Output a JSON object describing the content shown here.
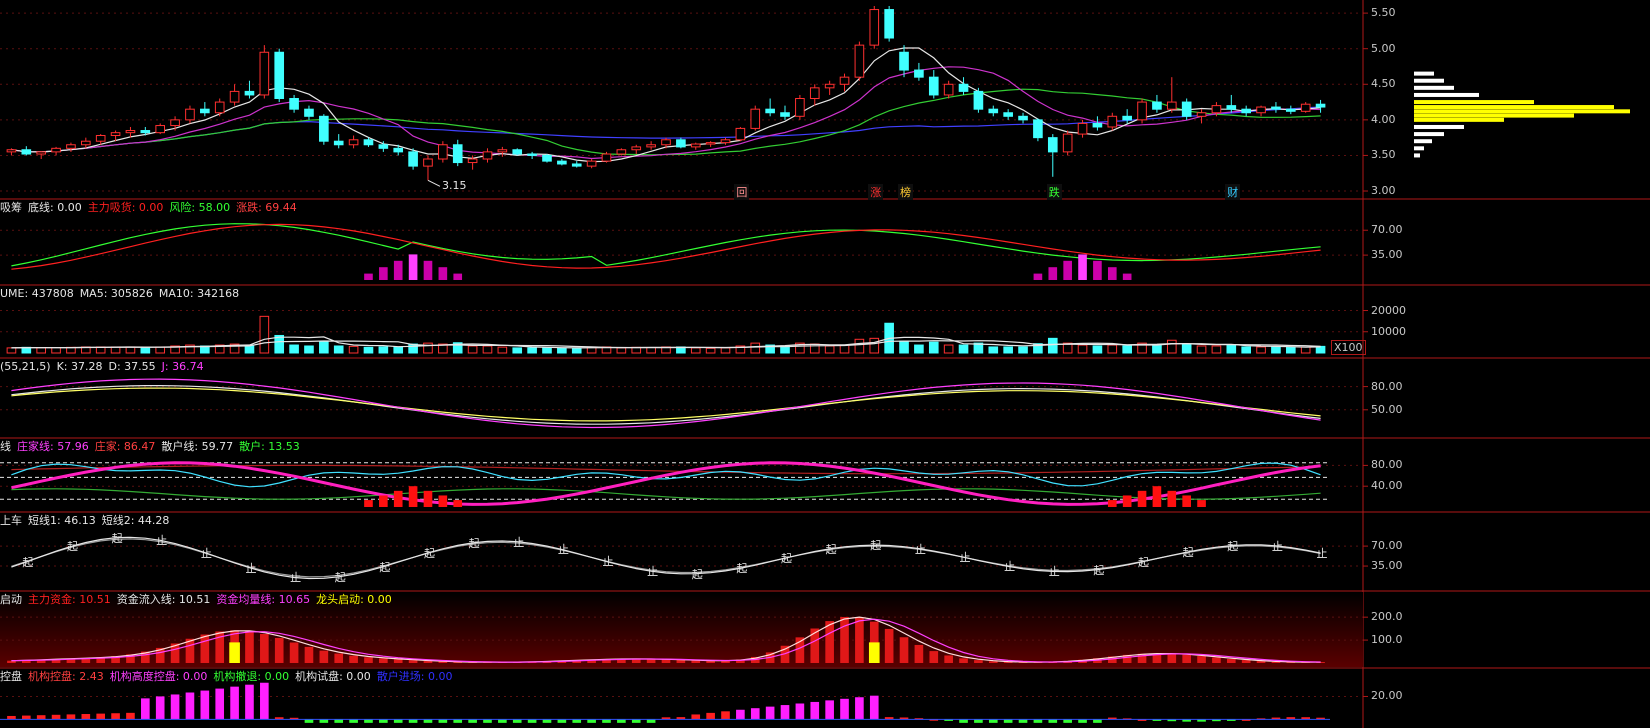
{
  "chart_data": {
    "type": "candlestick-multi-indicator",
    "panels": [
      {
        "id": "price",
        "yticks": [
          "5.50",
          "5.00",
          "4.50",
          "4.00",
          "3.50",
          "3.00"
        ],
        "ytick_values": [
          5.5,
          5.0,
          4.5,
          4.0,
          3.5,
          3.0
        ],
        "ylim": [
          2.93,
          5.6
        ],
        "low_marker": "3.15",
        "event_markers": [
          "回",
          "涨",
          "榜",
          "跌",
          "财"
        ],
        "candles_ohlc": [
          [
            3.55,
            3.6,
            3.5,
            3.58
          ],
          [
            3.58,
            3.63,
            3.5,
            3.52
          ],
          [
            3.52,
            3.56,
            3.45,
            3.55
          ],
          [
            3.55,
            3.62,
            3.5,
            3.6
          ],
          [
            3.6,
            3.68,
            3.55,
            3.65
          ],
          [
            3.65,
            3.75,
            3.6,
            3.7
          ],
          [
            3.7,
            3.8,
            3.65,
            3.78
          ],
          [
            3.78,
            3.85,
            3.7,
            3.82
          ],
          [
            3.82,
            3.9,
            3.75,
            3.85
          ],
          [
            3.85,
            3.9,
            3.78,
            3.82
          ],
          [
            3.82,
            3.95,
            3.8,
            3.92
          ],
          [
            3.92,
            4.05,
            3.85,
            4.0
          ],
          [
            4.0,
            4.2,
            3.95,
            4.15
          ],
          [
            4.15,
            4.25,
            4.05,
            4.1
          ],
          [
            4.1,
            4.3,
            4.05,
            4.25
          ],
          [
            4.25,
            4.5,
            4.2,
            4.4
          ],
          [
            4.4,
            4.55,
            4.3,
            4.35
          ],
          [
            4.35,
            5.05,
            4.3,
            4.95
          ],
          [
            4.95,
            5.0,
            4.25,
            4.3
          ],
          [
            4.3,
            4.35,
            4.1,
            4.15
          ],
          [
            4.15,
            4.2,
            4.0,
            4.05
          ],
          [
            4.05,
            4.08,
            3.65,
            3.7
          ],
          [
            3.7,
            3.8,
            3.6,
            3.65
          ],
          [
            3.65,
            3.78,
            3.6,
            3.72
          ],
          [
            3.72,
            3.75,
            3.62,
            3.65
          ],
          [
            3.65,
            3.7,
            3.55,
            3.6
          ],
          [
            3.6,
            3.65,
            3.5,
            3.55
          ],
          [
            3.55,
            3.6,
            3.3,
            3.35
          ],
          [
            3.35,
            3.5,
            3.15,
            3.45
          ],
          [
            3.45,
            3.7,
            3.4,
            3.65
          ],
          [
            3.65,
            3.72,
            3.35,
            3.4
          ],
          [
            3.4,
            3.5,
            3.3,
            3.45
          ],
          [
            3.45,
            3.6,
            3.4,
            3.55
          ],
          [
            3.55,
            3.62,
            3.48,
            3.58
          ],
          [
            3.58,
            3.6,
            3.5,
            3.52
          ],
          [
            3.52,
            3.55,
            3.45,
            3.5
          ],
          [
            3.5,
            3.52,
            3.4,
            3.42
          ],
          [
            3.42,
            3.45,
            3.36,
            3.38
          ],
          [
            3.38,
            3.42,
            3.33,
            3.35
          ],
          [
            3.35,
            3.45,
            3.32,
            3.42
          ],
          [
            3.42,
            3.55,
            3.4,
            3.52
          ],
          [
            3.52,
            3.6,
            3.5,
            3.58
          ],
          [
            3.58,
            3.65,
            3.52,
            3.62
          ],
          [
            3.62,
            3.7,
            3.58,
            3.65
          ],
          [
            3.65,
            3.75,
            3.6,
            3.72
          ],
          [
            3.72,
            3.75,
            3.6,
            3.62
          ],
          [
            3.62,
            3.68,
            3.58,
            3.66
          ],
          [
            3.66,
            3.7,
            3.62,
            3.68
          ],
          [
            3.68,
            3.75,
            3.65,
            3.72
          ],
          [
            3.72,
            3.9,
            3.7,
            3.88
          ],
          [
            3.88,
            4.2,
            3.85,
            4.15
          ],
          [
            4.15,
            4.3,
            4.05,
            4.1
          ],
          [
            4.1,
            4.2,
            4.0,
            4.05
          ],
          [
            4.05,
            4.35,
            4.0,
            4.3
          ],
          [
            4.3,
            4.5,
            4.2,
            4.45
          ],
          [
            4.45,
            4.55,
            4.35,
            4.5
          ],
          [
            4.5,
            4.65,
            4.4,
            4.6
          ],
          [
            4.6,
            5.1,
            4.55,
            5.05
          ],
          [
            5.05,
            5.6,
            5.0,
            5.55
          ],
          [
            5.55,
            5.6,
            5.1,
            5.15
          ],
          [
            4.95,
            5.05,
            4.6,
            4.7
          ],
          [
            4.7,
            4.8,
            4.55,
            4.6
          ],
          [
            4.6,
            4.7,
            4.3,
            4.35
          ],
          [
            4.35,
            4.55,
            4.3,
            4.5
          ],
          [
            4.5,
            4.6,
            4.35,
            4.4
          ],
          [
            4.4,
            4.45,
            4.1,
            4.15
          ],
          [
            4.15,
            4.2,
            4.05,
            4.1
          ],
          [
            4.1,
            4.15,
            4.0,
            4.05
          ],
          [
            4.05,
            4.1,
            3.95,
            4.0
          ],
          [
            4.0,
            4.02,
            3.7,
            3.75
          ],
          [
            3.75,
            3.8,
            3.2,
            3.55
          ],
          [
            3.55,
            3.85,
            3.5,
            3.8
          ],
          [
            3.8,
            4.0,
            3.75,
            3.95
          ],
          [
            3.95,
            4.05,
            3.85,
            3.9
          ],
          [
            3.9,
            4.1,
            3.85,
            4.05
          ],
          [
            4.05,
            4.15,
            3.95,
            4.0
          ],
          [
            4.0,
            4.3,
            3.95,
            4.25
          ],
          [
            4.25,
            4.35,
            4.1,
            4.15
          ],
          [
            4.15,
            4.6,
            4.1,
            4.25
          ],
          [
            4.25,
            4.3,
            4.0,
            4.05
          ],
          [
            4.05,
            4.15,
            3.95,
            4.1
          ],
          [
            4.1,
            4.25,
            4.05,
            4.2
          ],
          [
            4.2,
            4.35,
            4.1,
            4.15
          ],
          [
            4.15,
            4.2,
            4.05,
            4.1
          ],
          [
            4.1,
            4.2,
            4.05,
            4.18
          ],
          [
            4.18,
            4.25,
            4.1,
            4.15
          ],
          [
            4.15,
            4.2,
            4.08,
            4.12
          ],
          [
            4.12,
            4.25,
            4.1,
            4.22
          ],
          [
            4.22,
            4.28,
            4.1,
            4.18
          ]
        ]
      },
      {
        "id": "chip",
        "legend": [
          {
            "label": "吸筹",
            "value": "",
            "color": "#e6e6e6"
          },
          {
            "label": "底线",
            "value": "0.00",
            "color": "#e6e6e6"
          },
          {
            "label": "主力吸货",
            "value": "0.00",
            "color": "#ff2020"
          },
          {
            "label": "风险",
            "value": "58.00",
            "color": "#33ff33"
          },
          {
            "label": "涨跌",
            "value": "69.44",
            "color": "#ff4040"
          }
        ],
        "yticks": [
          "70.00",
          "35.00"
        ],
        "ytick_values": [
          70,
          35
        ],
        "ylim": [
          0,
          90
        ]
      },
      {
        "id": "volume",
        "legend": [
          {
            "label": "UME",
            "value": "437808",
            "color": "#e6e6e6"
          },
          {
            "label": "MA5",
            "value": "305826",
            "color": "#e6e6e6"
          },
          {
            "label": "MA10",
            "value": "342168",
            "color": "#e6e6e6"
          }
        ],
        "yticks": [
          "20000",
          "10000"
        ],
        "ytick_values": [
          20000,
          10000
        ],
        "ylim": [
          0,
          24000
        ],
        "unit": "X100"
      },
      {
        "id": "kdj",
        "legend": [
          {
            "label": "(55,21,5)",
            "value": "",
            "color": "#e6e6e6"
          },
          {
            "label": "K",
            "value": "37.28",
            "color": "#e6e6e6"
          },
          {
            "label": "D",
            "value": "37.55",
            "color": "#e6e6e6"
          },
          {
            "label": "J",
            "value": "36.74",
            "color": "#ff40ff"
          }
        ],
        "yticks": [
          "80.00",
          "50.00"
        ],
        "ytick_values": [
          80,
          50
        ],
        "ylim": [
          20,
          95
        ]
      },
      {
        "id": "dealer",
        "legend": [
          {
            "label": "线",
            "value": "",
            "color": "#e6e6e6"
          },
          {
            "label": "庄家线",
            "value": "57.96",
            "color": "#ff40ff"
          },
          {
            "label": "庄家",
            "value": "86.47",
            "color": "#ff4040"
          },
          {
            "label": "散户线",
            "value": "59.77",
            "color": "#e6e6e6"
          },
          {
            "label": "散户",
            "value": "13.53",
            "color": "#33ff33"
          }
        ],
        "yticks": [
          "80.00",
          "40.00"
        ],
        "ytick_values": [
          80,
          40
        ],
        "ylim": [
          0,
          100
        ]
      },
      {
        "id": "board",
        "legend": [
          {
            "label": "上车",
            "value": "",
            "color": "#e6e6e6"
          },
          {
            "label": "短线1",
            "value": "46.13",
            "color": "#e6e6e6"
          },
          {
            "label": "短线2",
            "value": "44.28",
            "color": "#e6e6e6"
          }
        ],
        "yticks": [
          "70.00",
          "35.00"
        ],
        "ytick_values": [
          70,
          35
        ],
        "ylim": [
          0,
          100
        ],
        "marker_up": "起",
        "marker_stop": "止"
      },
      {
        "id": "flow",
        "legend": [
          {
            "label": "启动",
            "value": "",
            "color": "#e6e6e6"
          },
          {
            "label": "主力资金",
            "value": "10.51",
            "color": "#ff2020"
          },
          {
            "label": "资金流入线",
            "value": "10.51",
            "color": "#e6e6e6"
          },
          {
            "label": "资金均量线",
            "value": "10.65",
            "color": "#ff40ff"
          },
          {
            "label": "龙头启动",
            "value": "0.00",
            "color": "#ffff00"
          }
        ],
        "yticks": [
          "200.0",
          "100.0"
        ],
        "ytick_values": [
          200,
          100
        ],
        "ylim": [
          0,
          240
        ]
      },
      {
        "id": "control",
        "legend": [
          {
            "label": "控盘",
            "value": "",
            "color": "#e6e6e6"
          },
          {
            "label": "机构控盘",
            "value": "2.43",
            "color": "#ff4040"
          },
          {
            "label": "机构高度控盘",
            "value": "0.00",
            "color": "#ff40ff"
          },
          {
            "label": "机构撤退",
            "value": "0.00",
            "color": "#33ff33"
          },
          {
            "label": "机构试盘",
            "value": "0.00",
            "color": "#e6e6e6"
          },
          {
            "label": "散户进场",
            "value": "0.00",
            "color": "#3030ff"
          }
        ],
        "yticks": [
          "20.00"
        ],
        "ytick_values": [
          20
        ],
        "ylim": [
          -4,
          30
        ]
      }
    ]
  }
}
